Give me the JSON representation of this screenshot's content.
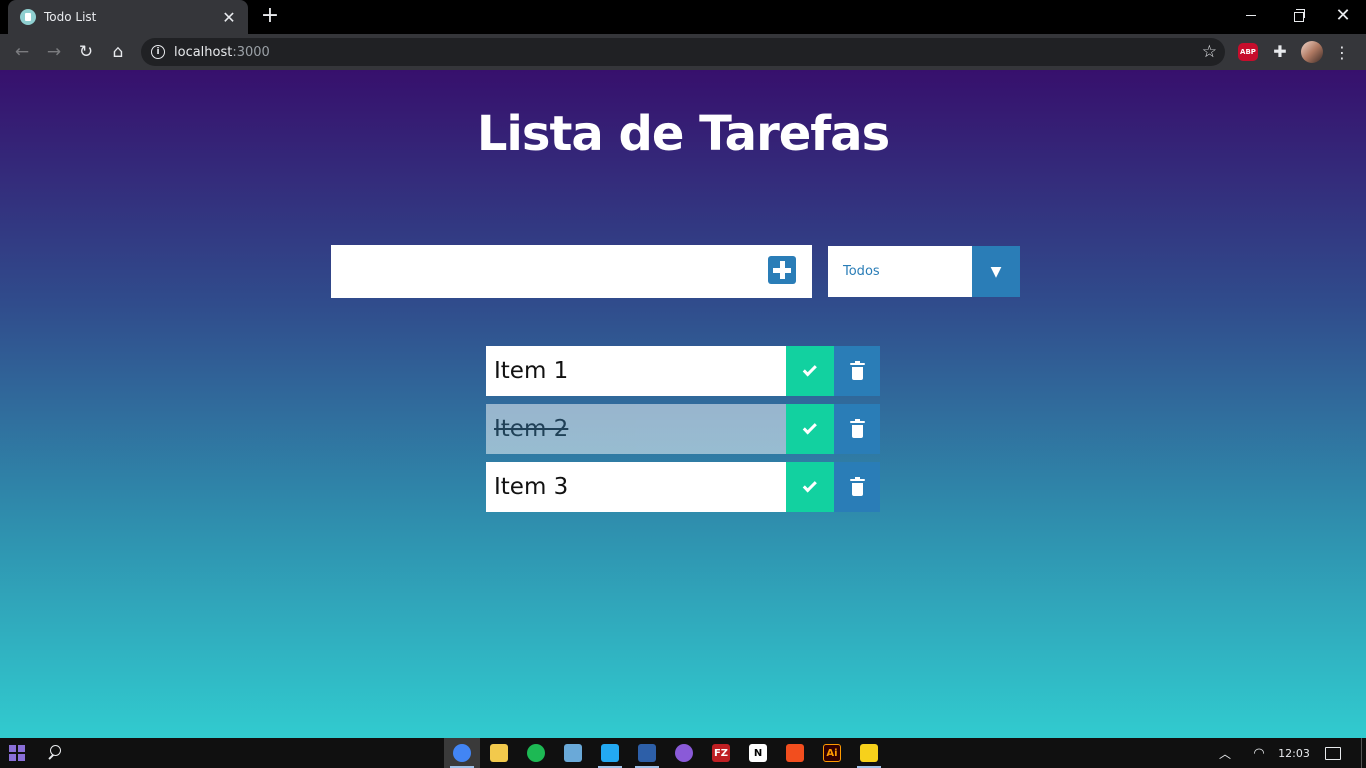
{
  "browser": {
    "tab_title": "Todo List",
    "tab_close": "✕",
    "new_tab": "+",
    "url_host": "localhost",
    "url_port": ":3000",
    "abp_label": "ABP"
  },
  "app": {
    "title": "Lista de Tarefas",
    "input": {
      "value": "",
      "placeholder": ""
    },
    "filter": {
      "selected": "Todos"
    },
    "todos": [
      {
        "text": "Item 1",
        "completed": false
      },
      {
        "text": "Item 2",
        "completed": true
      },
      {
        "text": "Item 3",
        "completed": false
      }
    ]
  },
  "taskbar": {
    "clock": "12:03",
    "apps": [
      {
        "name": "chrome-icon",
        "label": "",
        "color": "#4285f4",
        "active": true,
        "running": true
      },
      {
        "name": "file-explorer-icon",
        "label": "",
        "color": "#f2c94c",
        "active": false,
        "running": false
      },
      {
        "name": "spotify-icon",
        "label": "",
        "color": "#1db954",
        "active": false,
        "running": false
      },
      {
        "name": "notepad-icon",
        "label": "",
        "color": "#6aa9d8",
        "active": false,
        "running": false
      },
      {
        "name": "vscode-icon",
        "label": "",
        "color": "#23a9f2",
        "active": false,
        "running": true
      },
      {
        "name": "powershell-icon",
        "label": "",
        "color": "#2d5fa8",
        "active": false,
        "running": true
      },
      {
        "name": "github-desktop-icon",
        "label": "",
        "color": "#8a5ad8",
        "active": false,
        "running": false
      },
      {
        "name": "filezilla-icon",
        "label": "FZ",
        "color": "#bf1f23",
        "active": false,
        "running": false
      },
      {
        "name": "notion-icon",
        "label": "N",
        "color": "#ffffff",
        "active": false,
        "running": false
      },
      {
        "name": "figma-icon",
        "label": "",
        "color": "#f24e1e",
        "active": false,
        "running": false
      },
      {
        "name": "illustrator-icon",
        "label": "Ai",
        "color": "#330000",
        "active": false,
        "running": false
      },
      {
        "name": "sticky-notes-icon",
        "label": "",
        "color": "#f7d11b",
        "active": false,
        "running": true
      }
    ]
  },
  "colors": {
    "gradient_top": "#37106d",
    "gradient_bottom": "#31cbcf",
    "accent_blue": "#2a7db7",
    "check_green": "#12d1a0"
  }
}
